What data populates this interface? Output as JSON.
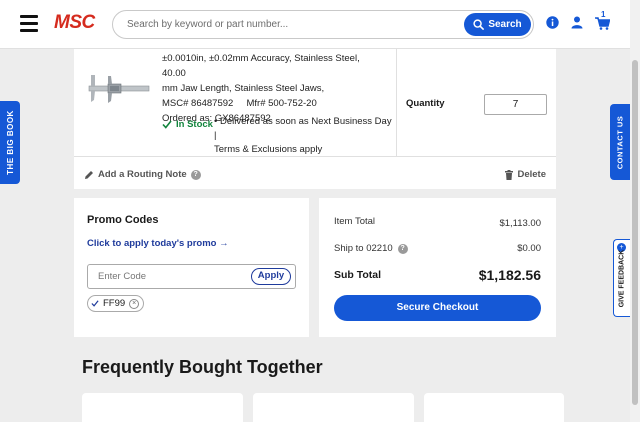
{
  "header": {
    "logo": "MSC",
    "search_placeholder": "Search by keyword or part number...",
    "search_button": "Search",
    "cart_count": "1"
  },
  "side_tabs": {
    "big_book": "THE BIG BOOK",
    "contact_us": "CONTACT US",
    "feedback": "GIVE FEEDBACK"
  },
  "cart_item": {
    "desc_lines": [
      "±0.0010in, ±0.02mm Accuracy, Stainless Steel, 40.00",
      "mm Jaw Length, Stainless Steel Jaws,",
      "MSC# 86487592     Mfr# 500-752-20",
      "Ordered as: GX86487592"
    ],
    "stock_status": "In Stock",
    "delivery_lines": [
      "• Delivered as soon as Next Business Day |",
      "Terms & Exclusions apply"
    ],
    "quantity_label": "Quantity",
    "quantity_value": "7",
    "routing_note": "Add a Routing Note",
    "delete": "Delete"
  },
  "promo": {
    "title": "Promo Codes",
    "link": "Click to apply today's promo →",
    "input_placeholder": "Enter Code",
    "apply": "Apply",
    "applied_code": "FF99"
  },
  "totals": {
    "item_total_label": "Item Total",
    "item_total_value": "$1,113.00",
    "ship_label": "Ship to 02210",
    "ship_value": "$0.00",
    "subtotal_label": "Sub Total",
    "subtotal_value": "$1,182.56",
    "checkout": "Secure Checkout"
  },
  "fbt": {
    "title": "Frequently Bought Together"
  },
  "colors": {
    "brand_blue": "#1558d6",
    "brand_red": "#d52b1e",
    "in_stock_green": "#12853d"
  }
}
